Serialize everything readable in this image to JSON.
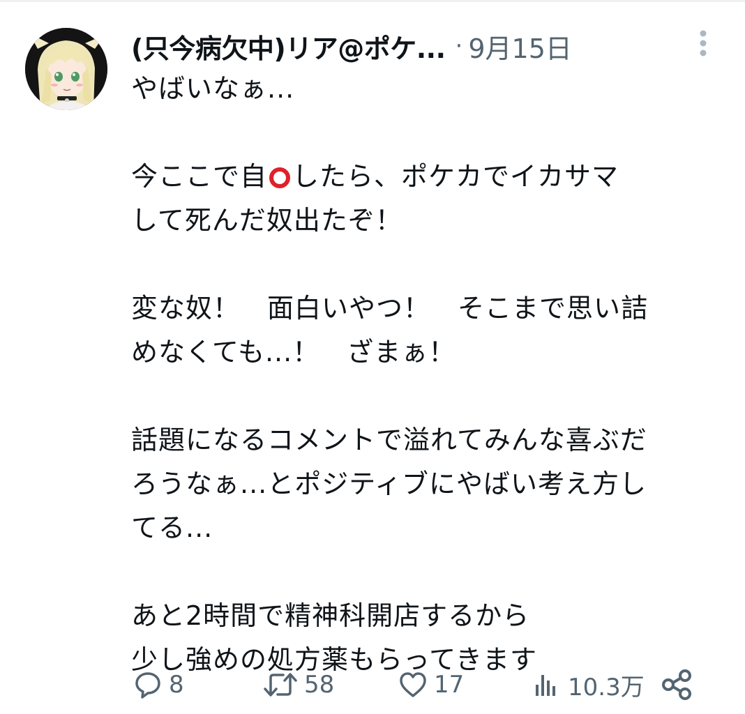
{
  "tweet": {
    "author": {
      "display_name": "(只今病欠中)リア@ポケ...",
      "avatar": "anime-girl-avatar"
    },
    "separator": "·",
    "timestamp": "9月15日",
    "body": {
      "p1": {
        "l1": "やばいなぁ..."
      },
      "p2": {
        "l1a": "今ここで自",
        "l1b": "したら、ポケカでイカサマ",
        "l2": "して死んだ奴出たぞ！"
      },
      "p3": {
        "l1": "変な奴！　面白いやつ！　そこまで思い詰",
        "l2": "めなくても...！　ざまぁ！"
      },
      "p4": {
        "l1": "話題になるコメントで溢れてみんな喜ぶだ",
        "l2": "ろうなぁ...とポジティブにやばい考え方し",
        "l3": "てる..."
      },
      "p5": {
        "l1": "あと2時間で精神科開店するから",
        "l2": "少し強めの処方薬もらってきます"
      }
    },
    "metrics": {
      "replies": "8",
      "retweets": "58",
      "likes": "17",
      "views": "10.3万"
    }
  },
  "icons": {
    "more": "more-vertical-icon",
    "reply": "reply-icon",
    "retweet": "retweet-icon",
    "like": "heart-icon",
    "views": "views-icon",
    "share": "share-icon"
  },
  "colors": {
    "text": "#0f1419",
    "secondary": "#536471",
    "more_dots": "#aab8c2",
    "ring": "#e0202a"
  }
}
